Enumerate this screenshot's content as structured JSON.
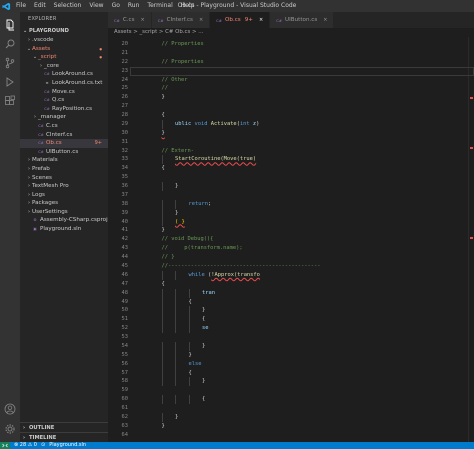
{
  "titlebar": {
    "menu": [
      "File",
      "Edit",
      "Selection",
      "View",
      "Go",
      "Run",
      "Terminal",
      "Help"
    ],
    "title": "Ob.cs - Playground - Visual Studio Code"
  },
  "activity_icons": [
    "files-icon",
    "search-icon",
    "source-control-icon",
    "run-debug-icon",
    "extensions-icon",
    "account-icon",
    "settings-gear-icon"
  ],
  "sidebar": {
    "header": "EXPLORER",
    "root": "PLAYGROUND",
    "items": [
      {
        "label": ".vscode",
        "depth": 1,
        "type": "folder",
        "expanded": false
      },
      {
        "label": "Assets",
        "depth": 1,
        "type": "folder",
        "expanded": true,
        "state": "err"
      },
      {
        "label": "_script",
        "depth": 2,
        "type": "folder",
        "expanded": true,
        "state": "err"
      },
      {
        "label": "_core",
        "depth": 3,
        "type": "folder",
        "expanded": false
      },
      {
        "label": "LookAround.cs",
        "depth": 3,
        "type": "cs"
      },
      {
        "label": "LookAround.cs.txt",
        "depth": 3,
        "type": "txt"
      },
      {
        "label": "Move.cs",
        "depth": 3,
        "type": "cs"
      },
      {
        "label": "Q.cs",
        "depth": 3,
        "type": "cs"
      },
      {
        "label": "RayPosition.cs",
        "depth": 3,
        "type": "cs"
      },
      {
        "label": "_manager",
        "depth": 2,
        "type": "folder",
        "expanded": false
      },
      {
        "label": "C.cs",
        "depth": 2,
        "type": "cs"
      },
      {
        "label": "CInterf.cs",
        "depth": 2,
        "type": "cs"
      },
      {
        "label": "Ob.cs",
        "depth": 2,
        "type": "cs",
        "state": "err",
        "active": true,
        "badge": "9+"
      },
      {
        "label": "UIButton.cs",
        "depth": 2,
        "type": "cs"
      },
      {
        "label": "Materials",
        "depth": 1,
        "type": "folder",
        "expanded": false
      },
      {
        "label": "Prefab",
        "depth": 1,
        "type": "folder",
        "expanded": false
      },
      {
        "label": "Scenes",
        "depth": 1,
        "type": "folder",
        "expanded": false
      },
      {
        "label": "TextMesh Pro",
        "depth": 1,
        "type": "folder",
        "expanded": false
      },
      {
        "label": "Logs",
        "depth": 1,
        "type": "folder",
        "expanded": false
      },
      {
        "label": "Packages",
        "depth": 1,
        "type": "folder",
        "expanded": false
      },
      {
        "label": "UserSettings",
        "depth": 1,
        "type": "folder",
        "expanded": false
      },
      {
        "label": "Assembly-CSharp.csproj",
        "depth": 1,
        "type": "csproj"
      },
      {
        "label": "Playground.sln",
        "depth": 1,
        "type": "sln"
      }
    ],
    "outline": "OUTLINE",
    "timeline": "TIMELINE"
  },
  "tabs": [
    {
      "label": "C.cs",
      "active": false
    },
    {
      "label": "CInterf.cs",
      "active": false
    },
    {
      "label": "Ob.cs",
      "active": true,
      "badge": "9+"
    },
    {
      "label": "UIButton.cs",
      "active": false
    }
  ],
  "breadcrumb": "Assets  >  _script  >  C# Ob.cs  >  ...",
  "editor": {
    "lines": [
      {
        "n": 20,
        "indent": 1,
        "parts": [
          [
            "c-comment",
            "// Properties"
          ]
        ]
      },
      {
        "n": 21,
        "indent": 0,
        "parts": []
      },
      {
        "n": 22,
        "indent": 1,
        "parts": [
          [
            "c-comment",
            "// Properties"
          ]
        ]
      },
      {
        "n": 23,
        "indent": 0,
        "parts": [],
        "current": true
      },
      {
        "n": 24,
        "indent": 1,
        "parts": [
          [
            "c-comment",
            "// Other"
          ]
        ]
      },
      {
        "n": 25,
        "indent": 1,
        "parts": [
          [
            "c-comment",
            "//"
          ]
        ]
      },
      {
        "n": 26,
        "indent": 1,
        "parts": [
          [
            "c-punc",
            "}"
          ]
        ]
      },
      {
        "n": 27,
        "indent": 0,
        "parts": []
      },
      {
        "n": 28,
        "indent": 1,
        "parts": [
          [
            "c-punc",
            "{"
          ]
        ]
      },
      {
        "n": 29,
        "indent": 2,
        "parts": [
          [
            "c-id",
            "ublic "
          ],
          [
            "c-kw",
            "void "
          ],
          [
            "c-fn",
            "Activate"
          ],
          [
            "c-punc",
            "("
          ],
          [
            "c-kw",
            "int "
          ],
          [
            "c-id",
            "z"
          ],
          [
            "c-punc",
            ")"
          ]
        ]
      },
      {
        "n": 30,
        "indent": 1,
        "parts": [
          [
            "c-punc squig",
            "}"
          ]
        ]
      },
      {
        "n": 31,
        "indent": 0,
        "parts": []
      },
      {
        "n": 32,
        "indent": 1,
        "parts": [
          [
            "c-comment",
            "// Extern-"
          ]
        ]
      },
      {
        "n": 33,
        "indent": 2,
        "parts": [
          [
            "c-fn squig",
            "StartCoroutine(Move(true)"
          ]
        ]
      },
      {
        "n": 34,
        "indent": 1,
        "parts": [
          [
            "c-punc",
            "{"
          ]
        ]
      },
      {
        "n": 35,
        "indent": 0,
        "parts": []
      },
      {
        "n": 36,
        "indent": 2,
        "parts": [
          [
            "c-punc",
            "}"
          ]
        ]
      },
      {
        "n": 37,
        "indent": 0,
        "parts": []
      },
      {
        "n": 38,
        "indent": 3,
        "parts": [
          [
            "c-kw",
            "return"
          ],
          [
            "c-punc",
            ";"
          ]
        ]
      },
      {
        "n": 39,
        "indent": 2,
        "parts": [
          [
            "c-punc",
            "}"
          ]
        ]
      },
      {
        "n": 40,
        "indent": 2,
        "parts": [
          [
            "c-gold squig",
            "( }"
          ]
        ]
      },
      {
        "n": 41,
        "indent": 1,
        "parts": [
          [
            "c-punc",
            "}"
          ]
        ]
      },
      {
        "n": 42,
        "indent": 1,
        "parts": [
          [
            "c-comment",
            "// void Debug(){"
          ]
        ]
      },
      {
        "n": 43,
        "indent": 1,
        "parts": [
          [
            "c-comment",
            "//     p(transform.name);"
          ]
        ]
      },
      {
        "n": 44,
        "indent": 1,
        "parts": [
          [
            "c-comment",
            "// }"
          ]
        ]
      },
      {
        "n": 45,
        "indent": 1,
        "parts": [
          [
            "c-comment",
            "//-----------------------------------------------"
          ]
        ]
      },
      {
        "n": 46,
        "indent": 3,
        "parts": [
          [
            "c-kw",
            "while "
          ],
          [
            "c-punc",
            "("
          ],
          [
            "c-fn squig",
            "!Approx(transfo"
          ]
        ]
      },
      {
        "n": 47,
        "indent": 1,
        "parts": [
          [
            "c-punc",
            "{"
          ]
        ]
      },
      {
        "n": 48,
        "indent": 4,
        "parts": [
          [
            "c-id",
            "tran"
          ]
        ]
      },
      {
        "n": 49,
        "indent": 3,
        "parts": [
          [
            "c-punc",
            "{"
          ]
        ]
      },
      {
        "n": 50,
        "indent": 4,
        "parts": [
          [
            "c-punc",
            "}"
          ]
        ]
      },
      {
        "n": 51,
        "indent": 4,
        "parts": [
          [
            "c-punc",
            "{"
          ]
        ]
      },
      {
        "n": 52,
        "indent": 4,
        "parts": [
          [
            "c-id",
            "se"
          ]
        ]
      },
      {
        "n": 53,
        "indent": 0,
        "parts": []
      },
      {
        "n": 54,
        "indent": 4,
        "parts": [
          [
            "c-punc",
            "}"
          ]
        ]
      },
      {
        "n": 55,
        "indent": 3,
        "parts": [
          [
            "c-punc",
            "}"
          ]
        ]
      },
      {
        "n": 56,
        "indent": 3,
        "parts": [
          [
            "c-kw",
            "else"
          ]
        ]
      },
      {
        "n": 57,
        "indent": 3,
        "parts": [
          [
            "c-punc",
            "{"
          ]
        ]
      },
      {
        "n": 58,
        "indent": 4,
        "parts": [
          [
            "c-punc",
            "}"
          ]
        ]
      },
      {
        "n": 59,
        "indent": 0,
        "parts": []
      },
      {
        "n": 60,
        "indent": 4,
        "parts": [
          [
            "c-punc",
            "{"
          ]
        ]
      },
      {
        "n": 61,
        "indent": 0,
        "parts": []
      },
      {
        "n": 62,
        "indent": 2,
        "parts": [
          [
            "c-punc",
            "}"
          ]
        ]
      },
      {
        "n": 63,
        "indent": 1,
        "parts": [
          [
            "c-punc",
            "}"
          ]
        ]
      },
      {
        "n": 64,
        "indent": 0,
        "parts": []
      }
    ]
  },
  "statusbar": {
    "errors": "⊗ 28 ⚠ 0",
    "branch": "⊙",
    "project": "Playground.sln"
  },
  "colors": {
    "accent": "#007acc",
    "error": "#f48771",
    "modified": "#e2c08d"
  }
}
